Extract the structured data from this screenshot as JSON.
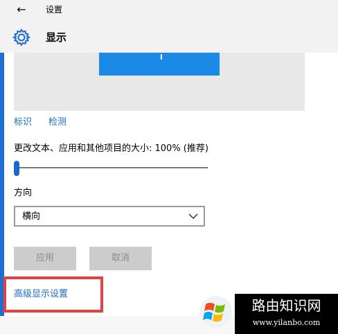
{
  "window": {
    "title": "设置",
    "back_icon": "←"
  },
  "header": {
    "page_title": "显示",
    "icon": "gear-icon"
  },
  "display_actions": {
    "identify_label": "标识",
    "detect_label": "检测"
  },
  "scale": {
    "label": "更改文本、应用和其他项目的大小: 100% (推荐)",
    "slider_value_percent": 0
  },
  "orientation": {
    "label": "方向",
    "selected_value": "横向"
  },
  "buttons": {
    "apply_label": "应用",
    "cancel_label": "取消"
  },
  "advanced": {
    "link_label": "高级显示设置"
  },
  "watermark": {
    "title": "路由知识网",
    "url": "www.yilanbo.com"
  },
  "colors": {
    "accent": "#1b6ac9",
    "monitor_tile": "#1a8ae6",
    "highlight_border": "#e84040",
    "button_disabled": "#cccccc"
  }
}
